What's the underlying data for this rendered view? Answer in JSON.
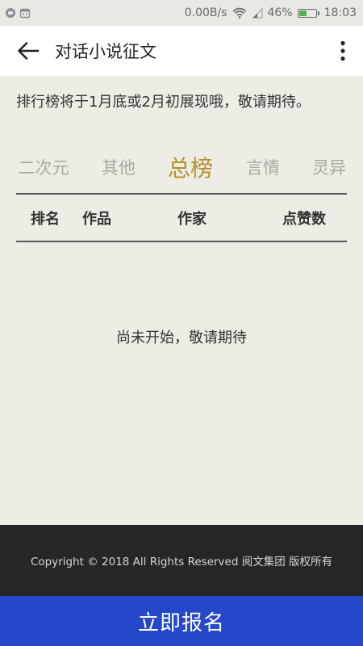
{
  "status_bar": {
    "icons": [
      "app-notification-icon",
      "calendar-notification-icon",
      "wifi-icon",
      "signal-icon",
      "battery-icon"
    ],
    "network_speed": "0.00B/s",
    "battery_percent": "46%",
    "battery_level": 0.46,
    "time": "18:03",
    "battery_color": "#4caf50"
  },
  "app_bar": {
    "title": "对话小说征文",
    "back_icon": "arrow-left-icon",
    "more_icon": "more-vertical-icon"
  },
  "content": {
    "notice": "排行榜将于1月底或2月初展现哦，敬请期待。",
    "tabs": [
      {
        "label": "二次元",
        "active": false
      },
      {
        "label": "其他",
        "active": false
      },
      {
        "label": "总榜",
        "active": true
      },
      {
        "label": "言情",
        "active": false
      },
      {
        "label": "灵异",
        "active": false
      }
    ],
    "columns": [
      "排名",
      "作品",
      "作家",
      "点赞数"
    ],
    "empty_message": "尚未开始，敬请期待"
  },
  "footer": {
    "copyright": "Copyright © 2018 All Rights Reserved 阅文集团 版权所有"
  },
  "signup": {
    "label": "立即报名"
  },
  "colors": {
    "accent_tab": "#b5922c",
    "inactive_tab": "#a9a9a4",
    "signup_bg": "#2448c9",
    "footer_bg": "#262626",
    "page_bg": "#edece5"
  }
}
